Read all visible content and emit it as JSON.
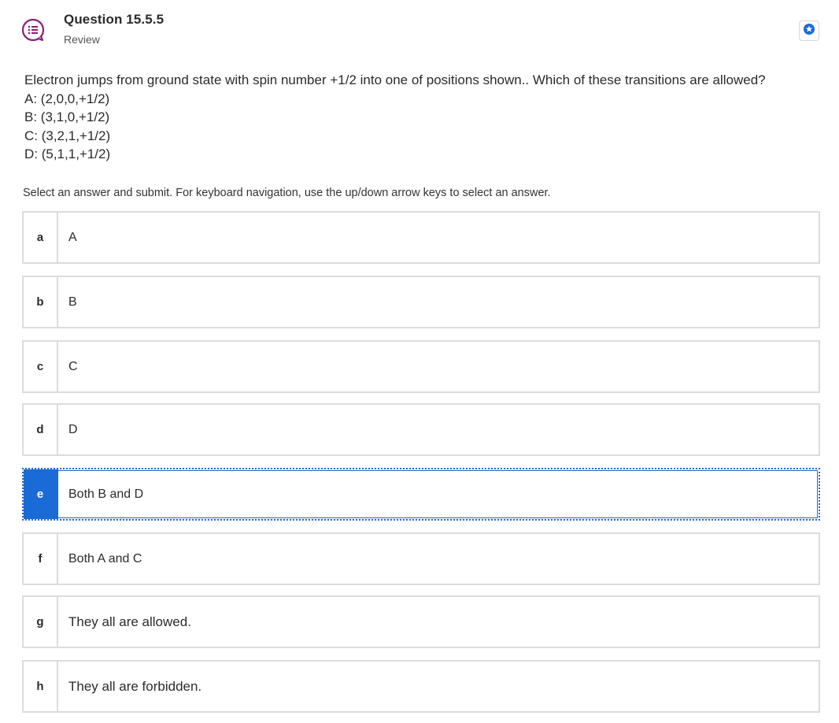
{
  "header": {
    "title": "Question 15.5.5",
    "subtitle": "Review",
    "question_icon": "question-list-icon",
    "star_icon": "star-icon",
    "brand_color": "#8a1f7a",
    "accent_color": "#1a6bd6"
  },
  "question": {
    "stem": "Electron jumps from ground state with spin number +1/2 into one of positions shown.. Which of these transitions are allowed?",
    "lines": [
      "A: (2,0,0,+1/2)",
      "B: (3,1,0,+1/2)",
      "C: (3,2,1,+1/2)",
      "D: (5,1,1,+1/2)"
    ]
  },
  "instructions": "Select an answer and submit. For keyboard navigation, use the up/down arrow keys to select an answer.",
  "options": [
    {
      "letter": "a",
      "text": "A",
      "selected": false
    },
    {
      "letter": "b",
      "text": "B",
      "selected": false
    },
    {
      "letter": "c",
      "text": "C",
      "selected": false
    },
    {
      "letter": "d",
      "text": "D",
      "selected": false
    },
    {
      "letter": "e",
      "text": "Both B and D",
      "selected": true
    },
    {
      "letter": "f",
      "text": "Both A and C",
      "selected": false
    },
    {
      "letter": "g",
      "text": "They all are allowed.",
      "selected": false
    },
    {
      "letter": "h",
      "text": "They all are forbidden.",
      "selected": false
    }
  ]
}
